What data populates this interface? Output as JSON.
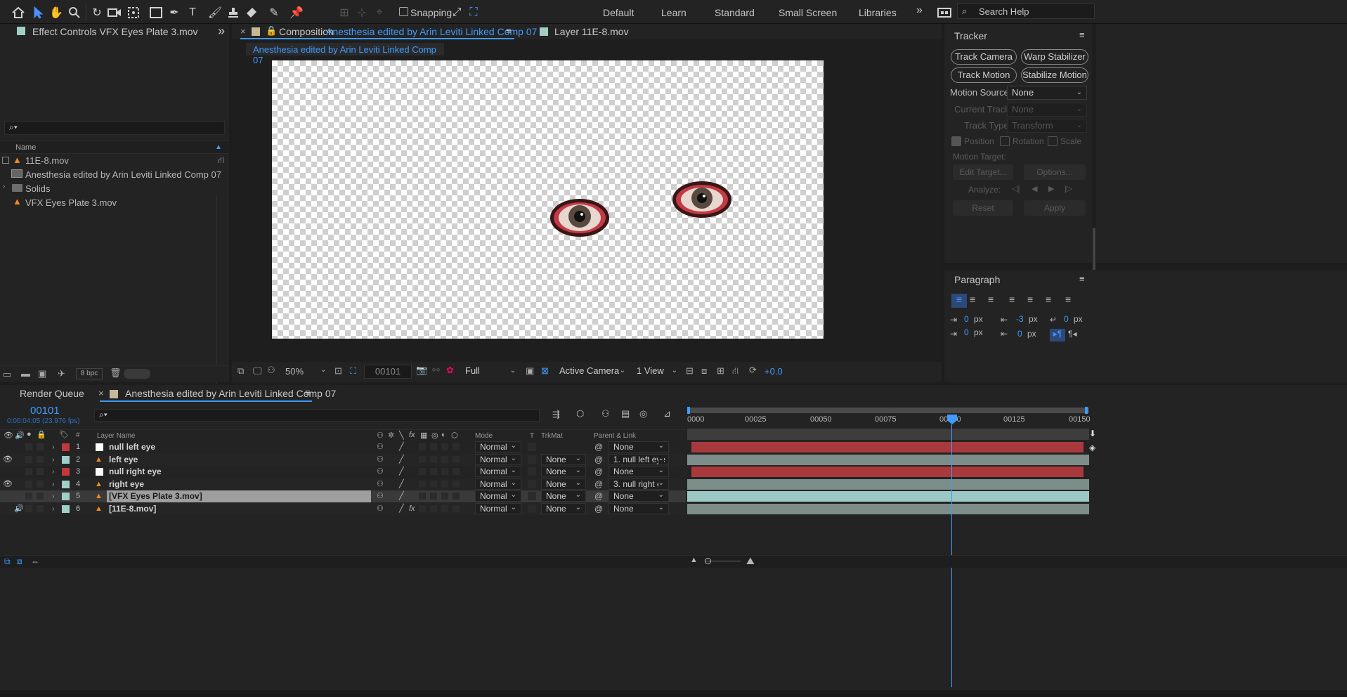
{
  "toolbar": {
    "snapping_label": "Snapping",
    "workspaces": [
      "Default",
      "Learn",
      "Standard",
      "Small Screen",
      "Libraries"
    ],
    "search_placeholder": "Search Help"
  },
  "project_panel": {
    "tab_label": "Effect Controls VFX Eyes Plate 3.mov",
    "name_header": "Name",
    "items": [
      {
        "label": "11E-8.mov",
        "icon": "vlc-cone-icon"
      },
      {
        "label": "Anesthesia edited by Arin Leviti Linked Comp 07",
        "icon": "composition-icon"
      },
      {
        "label": "Solids",
        "icon": "folder-icon"
      },
      {
        "label": "VFX Eyes Plate 3.mov",
        "icon": "vlc-cone-icon"
      }
    ],
    "bpc_label": "8 bpc"
  },
  "composition_panel": {
    "tab_prefix": "Composition",
    "tab_comp_name": "Anesthesia edited by Arin Leviti Linked Comp 07",
    "layer_tab": "Layer  11E-8.mov",
    "breadcrumb": "Anesthesia edited by Arin Leviti Linked Comp 07",
    "zoom": "50%",
    "timecode": "00101",
    "resolution": "Full",
    "camera": "Active Camera",
    "views": "1 View",
    "exposure": "+0.0"
  },
  "tracker_panel": {
    "title": "Tracker",
    "track_camera": "Track Camera",
    "warp_stabilizer": "Warp Stabilizer",
    "track_motion": "Track Motion",
    "stabilize_motion": "Stabilize Motion",
    "motion_source_label": "Motion Source:",
    "motion_source_value": "None",
    "current_track_label": "Current Track:",
    "current_track_value": "None",
    "track_type_label": "Track Type:",
    "track_type_value": "Transform",
    "position": "Position",
    "rotation": "Rotation",
    "scale": "Scale",
    "motion_target_label": "Motion Target:",
    "edit_target": "Edit Target...",
    "options": "Options...",
    "analyze_label": "Analyze:",
    "reset": "Reset",
    "apply": "Apply"
  },
  "paragraph_panel": {
    "title": "Paragraph",
    "indent_left": "0 px",
    "indent_right": "0 px",
    "space_before": "-3 px",
    "space_after": "0 px",
    "indent_first": "0 px"
  },
  "timeline": {
    "render_queue_tab": "Render Queue",
    "comp_tab": "Anesthesia edited by Arin Leviti Linked Comp 07",
    "current_time": "00101",
    "time_detail": "0:00:04:05 (23.976 fps)",
    "headers": {
      "layer_name": "Layer Name",
      "mode": "Mode",
      "t": "T",
      "trkmat": "TrkMat",
      "parent": "Parent & Link",
      "hash": "#"
    },
    "ruler": [
      "0000",
      "00025",
      "00050",
      "00075",
      "00100",
      "00125",
      "00150"
    ],
    "layers": [
      {
        "num": "1",
        "name": "null left eye",
        "mode": "Normal",
        "trkmat": "",
        "parent": "None",
        "label_color": "#c0393b",
        "bar_color": "#a8393c",
        "visible": false,
        "audio": false,
        "type": "null"
      },
      {
        "num": "2",
        "name": "left eye",
        "mode": "Normal",
        "trkmat": "None",
        "parent": "1. null left eye",
        "label_color": "#9fcfc7",
        "bar_color": "#7c8d8a",
        "visible": true,
        "audio": false,
        "type": "footage"
      },
      {
        "num": "3",
        "name": "null right eye",
        "mode": "Normal",
        "trkmat": "None",
        "parent": "None",
        "label_color": "#c0393b",
        "bar_color": "#a8393c",
        "visible": false,
        "audio": false,
        "type": "null"
      },
      {
        "num": "4",
        "name": "right eye",
        "mode": "Normal",
        "trkmat": "None",
        "parent": "3. null right e",
        "label_color": "#9fcfc7",
        "bar_color": "#7c8d8a",
        "visible": true,
        "audio": false,
        "type": "footage"
      },
      {
        "num": "5",
        "name": "[VFX Eyes Plate 3.mov]",
        "mode": "Normal",
        "trkmat": "None",
        "parent": "None",
        "label_color": "#9fcfc7",
        "bar_color": "#9cc8c3",
        "visible": false,
        "audio": false,
        "type": "footage",
        "selected": true
      },
      {
        "num": "6",
        "name": "[11E-8.mov]",
        "mode": "Normal",
        "trkmat": "None",
        "parent": "None",
        "label_color": "#9fcfc7",
        "bar_color": "#7c8d8a",
        "visible": false,
        "audio": true,
        "type": "footage"
      }
    ]
  }
}
